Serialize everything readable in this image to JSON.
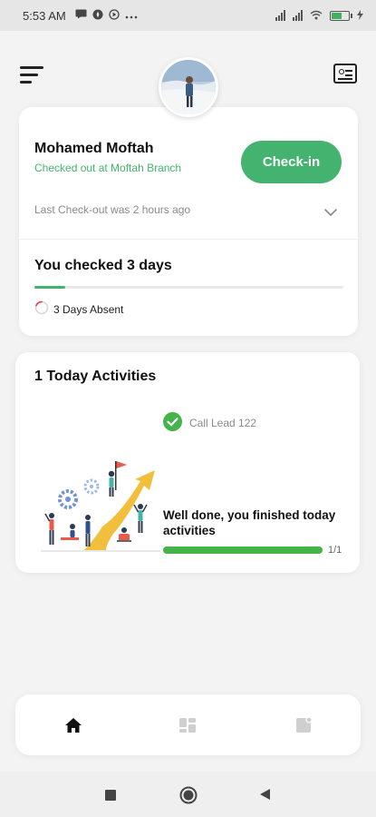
{
  "status_bar": {
    "time": "5:53 AM",
    "battery_level": 0.6,
    "icons": [
      "message-icon",
      "notification-icon",
      "media-icon",
      "more-icon",
      "signal-icon",
      "signal-icon",
      "wifi-icon",
      "battery-icon",
      "charging-icon"
    ]
  },
  "app_bar": {
    "menu_icon": "menu-icon",
    "card_icon": "id-card-icon"
  },
  "profile": {
    "name": "Mohamed Moftah",
    "status": "Checked out at Moftah Branch",
    "checkin_label": "Check-in",
    "last_checkout": "Last Check-out was 2 hours ago",
    "checked_days_text": "You checked 3 days",
    "checked_progress": 0.1,
    "absent_text": "3 Days Absent"
  },
  "activities": {
    "title": "1 Today Activities",
    "items": [
      {
        "label": "Call Lead 122",
        "done": true
      }
    ],
    "summary": "Well done, you finished today activities",
    "progress": 1.0,
    "count_text": "1/1"
  },
  "bottom_nav": {
    "items": [
      {
        "icon": "home-icon",
        "active": true
      },
      {
        "icon": "dashboard-icon",
        "active": false
      },
      {
        "icon": "notes-icon",
        "active": false
      }
    ]
  },
  "system_nav": {
    "buttons": [
      "recents-icon",
      "home-circle-icon",
      "back-icon"
    ]
  },
  "colors": {
    "accent_green": "#43b36f",
    "status_green": "#41b668",
    "absent_red": "#e0475c"
  }
}
